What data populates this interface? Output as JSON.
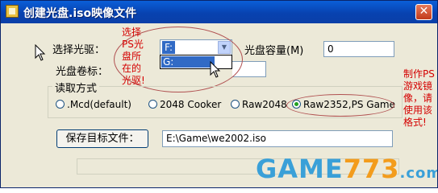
{
  "window": {
    "title": "创建光盘.iso映像文件",
    "close_glyph": "✕"
  },
  "form": {
    "drive_label": "选择光驱：",
    "drive_value": "F:",
    "drive_dropdown_item": "G:",
    "capacity_label": "光盘容量(M)",
    "capacity_value": "0",
    "volume_label": "光盘卷标：",
    "volume_value": ""
  },
  "read_mode": {
    "title": "读取方式",
    "options": [
      {
        "label": ".Mcd(default)",
        "checked": false
      },
      {
        "label": "2048 Cooker",
        "checked": false
      },
      {
        "label": "Raw2048",
        "checked": false
      },
      {
        "label": "Raw2352,PS Game",
        "checked": true
      }
    ]
  },
  "save": {
    "button_label": "保存目标文件：",
    "path": "E:\\Game\\we2002.iso"
  },
  "progress": {
    "value": 0
  },
  "annotations": {
    "drive_note": "选择\nPS光\n盘所\n在的\n光驱!",
    "mode_note": "制作PS\n游戏镜\n像，请\n使用该\n格式!"
  },
  "watermark": {
    "main": "GAME",
    "number": "773",
    "tld": ".com"
  },
  "colors": {
    "annotation": "#d40000",
    "title_bar": "#0842b0",
    "watermark_blue": "#3aa0d8",
    "watermark_orange": "#f39c1c"
  }
}
